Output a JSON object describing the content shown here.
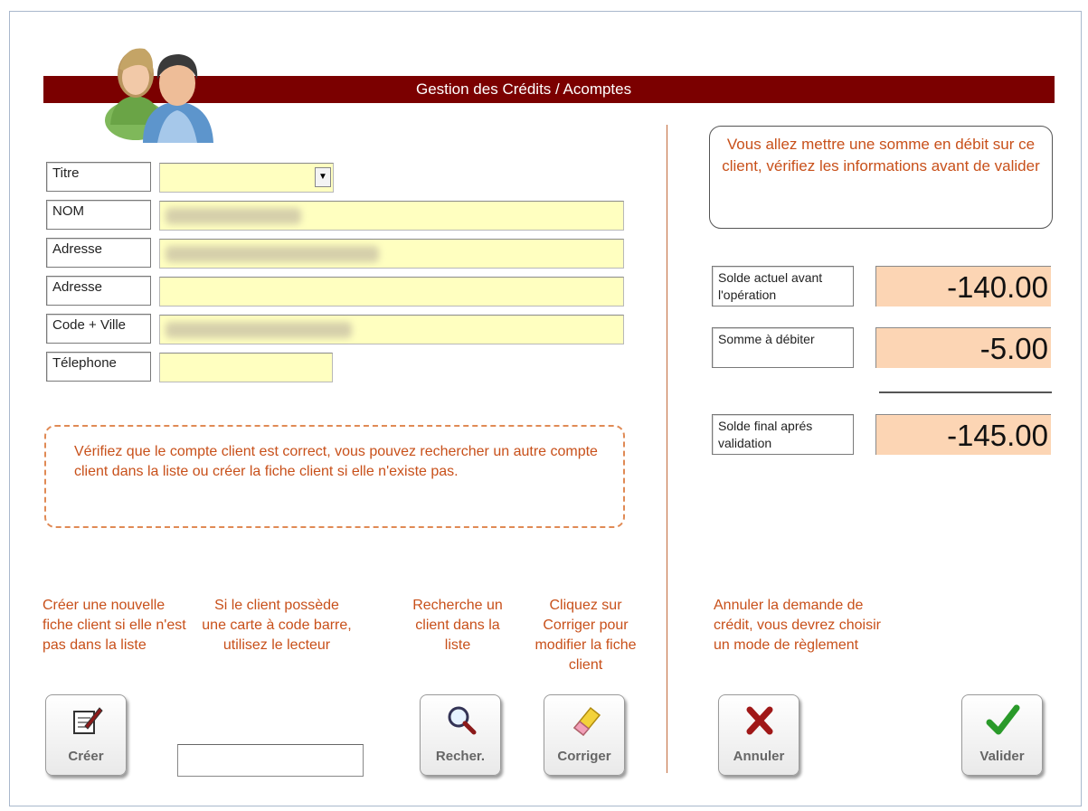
{
  "title": "Gestion des Crédits / Acomptes",
  "form": {
    "titre_label": "Titre",
    "nom_label": "NOM",
    "adresse1_label": "Adresse",
    "adresse2_label": "Adresse",
    "ville_label": "Code + Ville",
    "telephone_label": "Télephone",
    "dropdown_arrow": "▼"
  },
  "info_message": "Vérifiez que le compte client est correct, vous pouvez rechercher un autre compte client dans la liste ou créer la fiche client si elle n'existe pas.",
  "warning_message": "Vous allez mettre une somme en débit sur ce client, vérifiez les informations avant de valider",
  "solde": {
    "actuel_label": "Solde actuel avant l'opération",
    "actuel_value": "-140.00",
    "debit_label": "Somme à débiter",
    "debit_value": "-5.00",
    "final_label": "Solde final aprés validation",
    "final_value": "-145.00"
  },
  "help": {
    "creer": "Créer une nouvelle fiche client si elle n'est pas dans la liste",
    "carte": "Si le client possède une carte à code barre, utilisez le lecteur",
    "recherche": "Recherche un client dans la liste",
    "corriger": "Cliquez sur Corriger pour modifier la fiche client",
    "annuler": "Annuler la demande de crédit, vous devrez choisir un mode de règlement"
  },
  "buttons": {
    "creer": "Créer",
    "recher": "Recher.",
    "corriger": "Corriger",
    "annuler": "Annuler",
    "valider": "Valider"
  },
  "colors": {
    "title_bar": "#7b0000",
    "field_yellow": "#ffffc0",
    "amount_bg": "#fcd5b4",
    "help_text": "#c8501a"
  }
}
